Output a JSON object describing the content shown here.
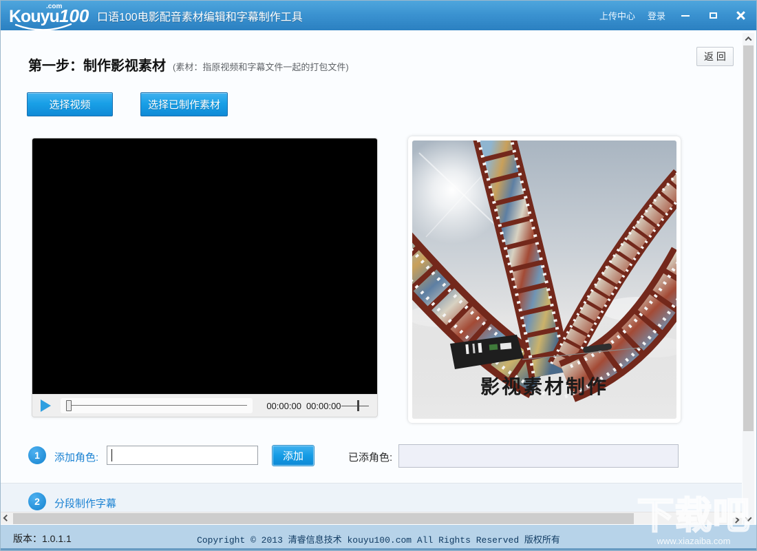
{
  "header": {
    "logo": {
      "kouyu": "Kouyu",
      "com": ".com",
      "hundred": "100"
    },
    "app_title": "口语100电影配音素材编辑和字幕制作工具",
    "upload_center": "上传中心",
    "login": "登录"
  },
  "main": {
    "back_button": "返 回",
    "step1_title": "第一步：制作影视素材",
    "step1_note": "(素材：指原视频和字幕文件一起的打包文件)",
    "select_video_button": "选择视频",
    "select_material_button": "选择已制作素材",
    "player": {
      "current_time": "00:00:00",
      "total_time": "00:00:00"
    },
    "preview_caption": "影视素材制作",
    "role_section": {
      "badge": "1",
      "label": "添加角色:",
      "input_value": "",
      "add_button": "添加",
      "added_label": "已添角色:",
      "added_value": ""
    },
    "subtitle_section": {
      "badge": "2",
      "label": "分段制作字幕"
    }
  },
  "footer": {
    "version": "版本：1.0.1.1",
    "copyright": "Copyright © 2013 清睿信息技术 kouyu100.com All Rights Reserved 版权所有"
  },
  "watermark": {
    "title": "下载吧",
    "url": "www.xiazaiba.com"
  },
  "colors": {
    "accent": "#1b8ce0",
    "header_top": "#4fa6dd",
    "header_bottom": "#2b80c1",
    "button_blue": "#149ce5",
    "footer_bg": "#b7d3e9",
    "film_strip": "#73281b"
  }
}
